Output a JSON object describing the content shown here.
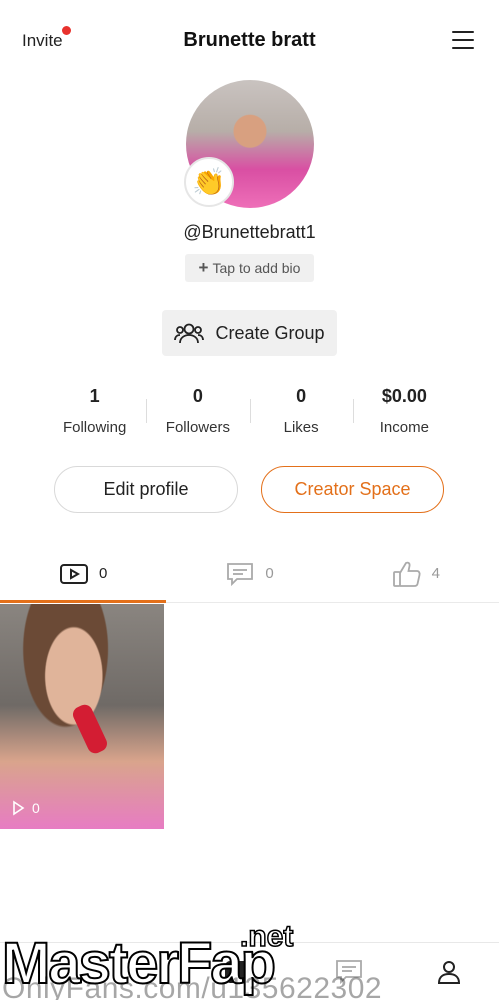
{
  "header": {
    "invite_label": "Invite",
    "title": "Brunette bratt",
    "menu_icon": "hamburger-icon"
  },
  "profile": {
    "badge_emoji": "👏",
    "handle": "@Brunettebratt1",
    "bio_button_label": "Tap to add bio",
    "group_button_label": "Create Group"
  },
  "stats": [
    {
      "value": "1",
      "label": "Following"
    },
    {
      "value": "0",
      "label": "Followers"
    },
    {
      "value": "0",
      "label": "Likes"
    },
    {
      "value": "$0.00",
      "label": "Income"
    }
  ],
  "actions": {
    "edit_label": "Edit profile",
    "creator_label": "Creator Space"
  },
  "tabs": [
    {
      "icon": "video-icon",
      "count": "0",
      "active": true
    },
    {
      "icon": "comment-icon",
      "count": "0",
      "active": false
    },
    {
      "icon": "thumbs-up-icon",
      "count": "4",
      "active": false
    }
  ],
  "videos": [
    {
      "views": "0"
    }
  ],
  "watermark": {
    "brand_text": "MasterFap",
    "brand_suffix": ".net",
    "url_text": "OnlyFans.com/u135622302"
  },
  "colors": {
    "accent": "#e3701a",
    "notification_dot": "#e8322d"
  }
}
